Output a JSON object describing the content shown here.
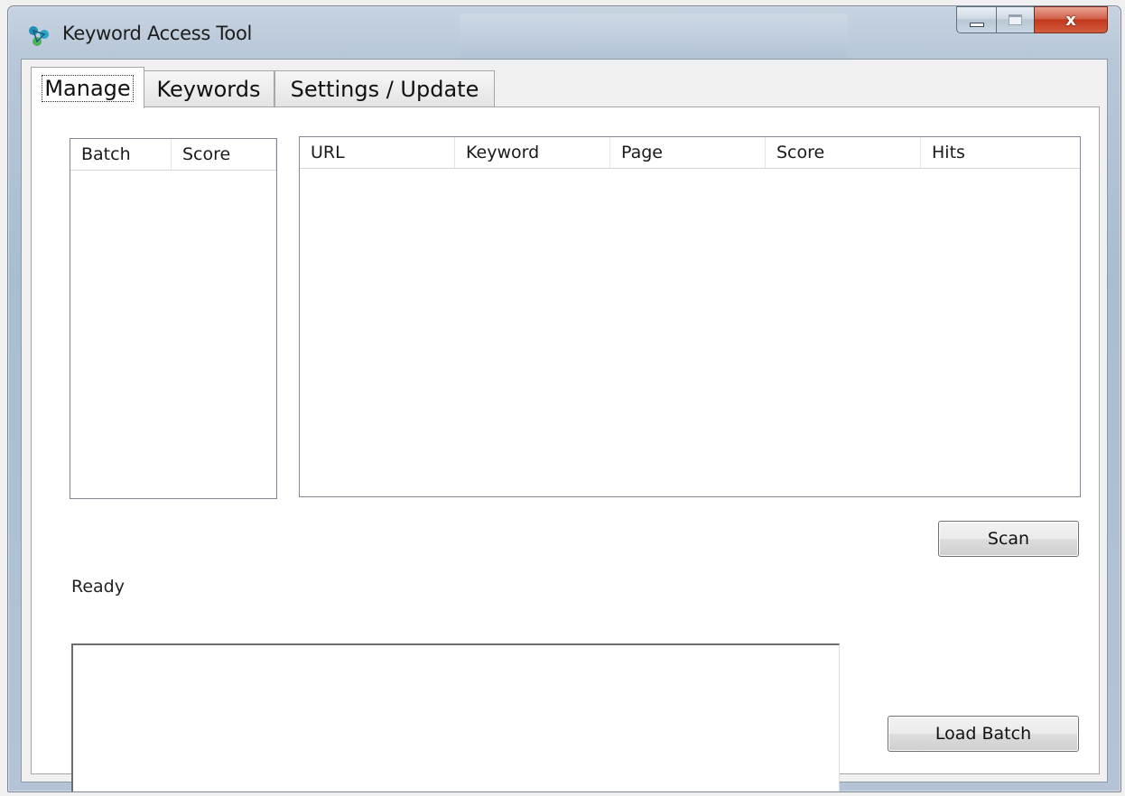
{
  "window": {
    "title": "Keyword Access Tool",
    "close_glyph": "x"
  },
  "tabs": [
    {
      "label": "Manage",
      "active": true
    },
    {
      "label": "Keywords",
      "active": false
    },
    {
      "label": "Settings / Update",
      "active": false
    }
  ],
  "batch_list": {
    "columns": [
      "Batch",
      "Score"
    ],
    "rows": []
  },
  "results_list": {
    "columns": [
      "URL",
      "Keyword",
      "Page",
      "Score",
      "Hits"
    ],
    "rows": []
  },
  "status": {
    "text": "Ready"
  },
  "log": {
    "value": ""
  },
  "buttons": {
    "scan": "Scan",
    "load_batch": "Load Batch"
  },
  "icons": {
    "app": "keyword-tool-icon",
    "minimize": "minimize-icon",
    "maximize": "maximize-icon",
    "close": "close-icon"
  },
  "colors": {
    "close_button": "#c2391d",
    "frame": "#b7c7d8"
  }
}
